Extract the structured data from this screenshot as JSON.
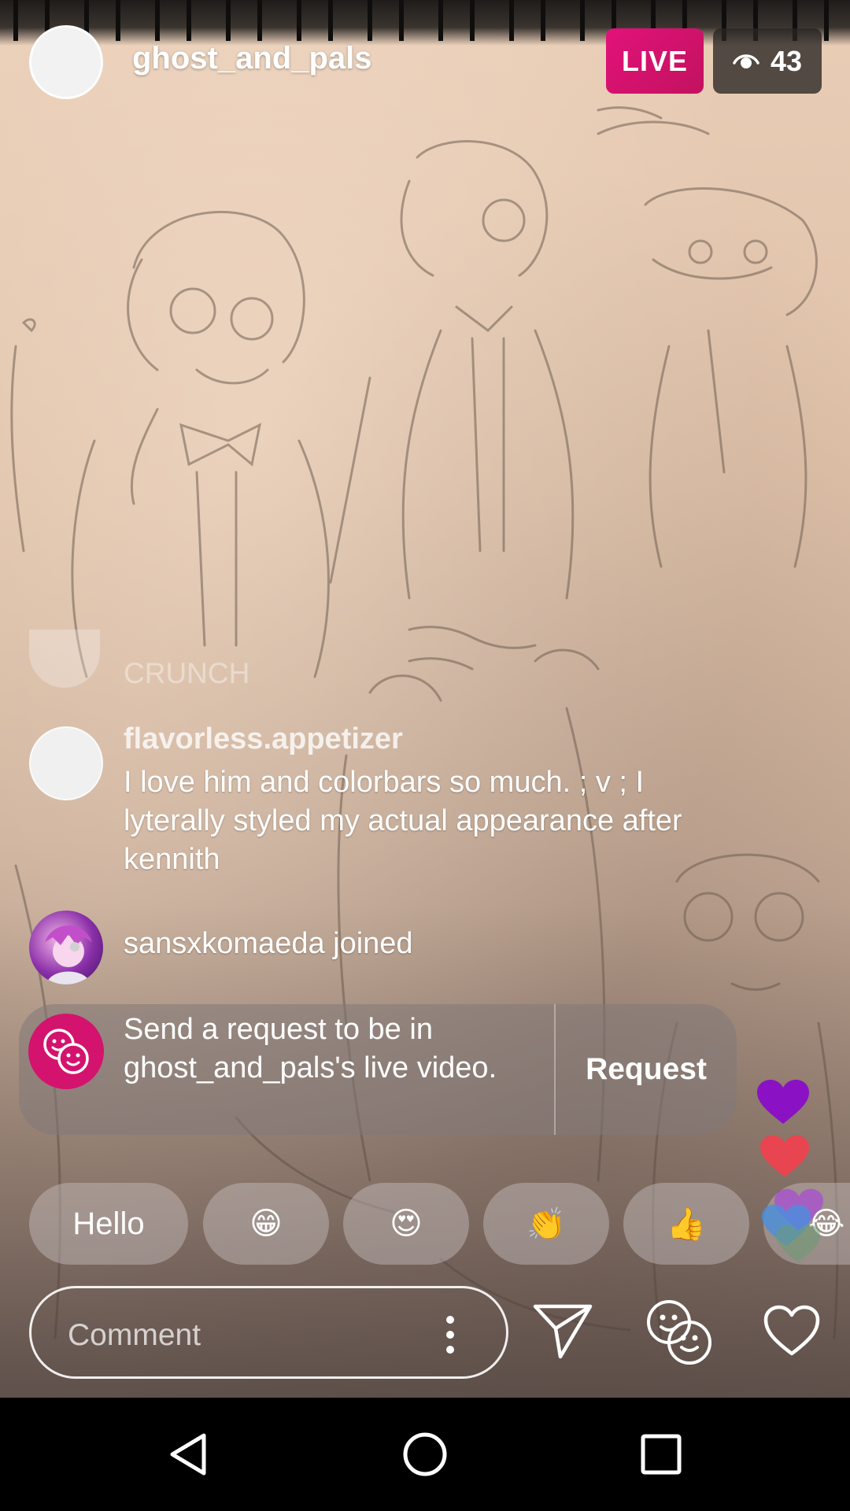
{
  "stream": {
    "host_username": "ghost_and_pals",
    "live_label": "LIVE",
    "viewer_count": "43",
    "eye_icon": "eye-icon"
  },
  "comments": {
    "faded": {
      "text": "CRUNCH"
    },
    "latest": {
      "username": "flavorless.appetizer",
      "text": "I love him and colorbars so much. ; v ;  I lyterally styled my actual appearance after kennith"
    },
    "joined": {
      "text": "sansxkomaeda joined"
    }
  },
  "request": {
    "text": "Send a request to be in ghost_and_pals's live video.",
    "button_label": "Request",
    "icon": "faces-icon"
  },
  "quick_reactions": [
    "Hello",
    "😁",
    "😍",
    "👏",
    "👍",
    "😂"
  ],
  "comment_bar": {
    "placeholder": "Comment",
    "icons": [
      "more-vertical-icon",
      "send-icon",
      "faces-icon",
      "heart-outline-icon"
    ]
  },
  "floating_hearts": {
    "colors": [
      "#8a12c4",
      "#e84550",
      "#8a12c4",
      "#4a8fe0",
      "#6a9c74"
    ]
  },
  "nav": {
    "icons": [
      "back-icon",
      "home-icon",
      "recents-icon"
    ]
  },
  "colors": {
    "live_badge": "#d4136e",
    "request_icon_bg": "#d4136e"
  }
}
